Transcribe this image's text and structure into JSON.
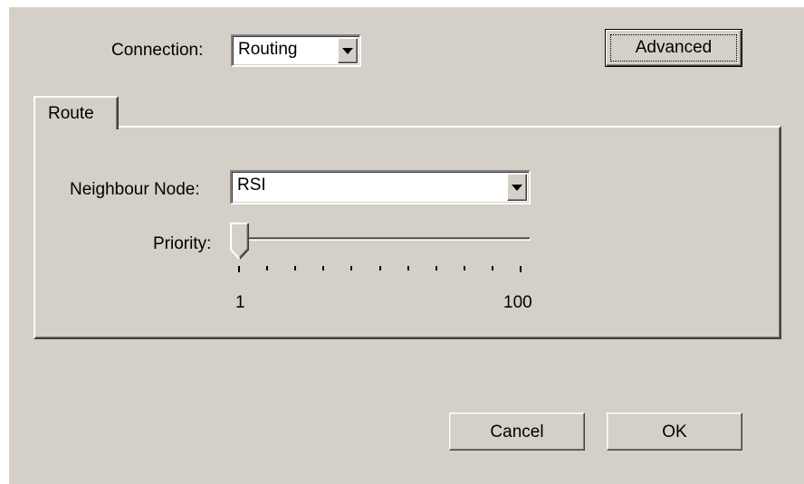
{
  "connection": {
    "label": "Connection:",
    "value": "Routing"
  },
  "advanced_button": {
    "label": "Advanced"
  },
  "tabs": [
    {
      "label": "Route"
    }
  ],
  "route": {
    "neighbour_node": {
      "label": "Neighbour Node:",
      "value": "RSI"
    },
    "priority": {
      "label": "Priority:",
      "min_label": "1",
      "max_label": "100",
      "value": 1,
      "min": 1,
      "max": 100
    }
  },
  "footer": {
    "cancel_label": "Cancel",
    "ok_label": "OK"
  }
}
